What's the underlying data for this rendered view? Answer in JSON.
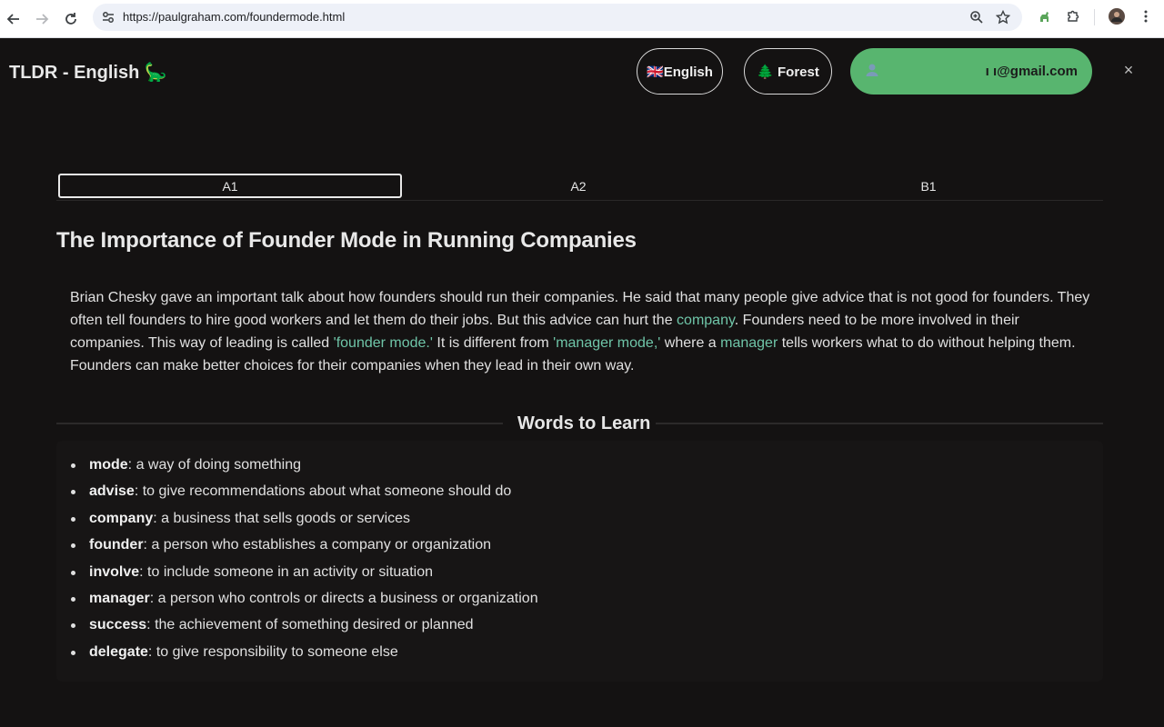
{
  "browser": {
    "url": "https://paulgraham.com/foundermode.html",
    "icons": [
      "back-icon",
      "forward-icon",
      "reload-icon",
      "site-settings-icon",
      "zoom-icon",
      "bookmark-star-icon",
      "extension-dino-icon",
      "extensions-puzzle-icon",
      "profile-avatar",
      "menu-kebab-icon"
    ]
  },
  "header": {
    "title": "TLDR - English 🦕",
    "language_button": "🇬🇧English",
    "theme_button": "🌲 Forest",
    "user_email": "ı                              ı@gmail.com",
    "close_label": "×",
    "accent_color": "#58b56f"
  },
  "levels": {
    "tabs": [
      "A1",
      "A2",
      "B1"
    ],
    "active": "A1"
  },
  "article": {
    "title": "The Importance of Founder Mode in Running Companies",
    "seg1": "Brian Chesky gave an important talk about how founders should run their companies. He said that many people give advice that is not good for founders. They often tell founders to hire good workers and let them do their jobs. But this advice can hurt the ",
    "hl1": "company",
    "seg2": ". Founders need to be more involved in their companies. This way of leading is called ",
    "hl2": "'founder mode.'",
    "seg3": " It is different from ",
    "hl3": "'manager mode,'",
    "seg4": " where a ",
    "hl4": "manager",
    "seg5": " tells workers what to do without helping them. Founders can make better choices for their companies when they lead in their own way.",
    "highlight_color": "#6fc5a8"
  },
  "words": {
    "title": "Words to Learn",
    "items": [
      {
        "term": "mode",
        "def": ": a way of doing something"
      },
      {
        "term": "advise",
        "def": ": to give recommendations about what someone should do"
      },
      {
        "term": "company",
        "def": ": a business that sells goods or services"
      },
      {
        "term": "founder",
        "def": ": a person who establishes a company or organization"
      },
      {
        "term": "involve",
        "def": ": to include someone in an activity or situation"
      },
      {
        "term": "manager",
        "def": ": a person who controls or directs a business or organization"
      },
      {
        "term": "success",
        "def": ": the achievement of something desired or planned"
      },
      {
        "term": "delegate",
        "def": ": to give responsibility to someone else"
      }
    ]
  }
}
